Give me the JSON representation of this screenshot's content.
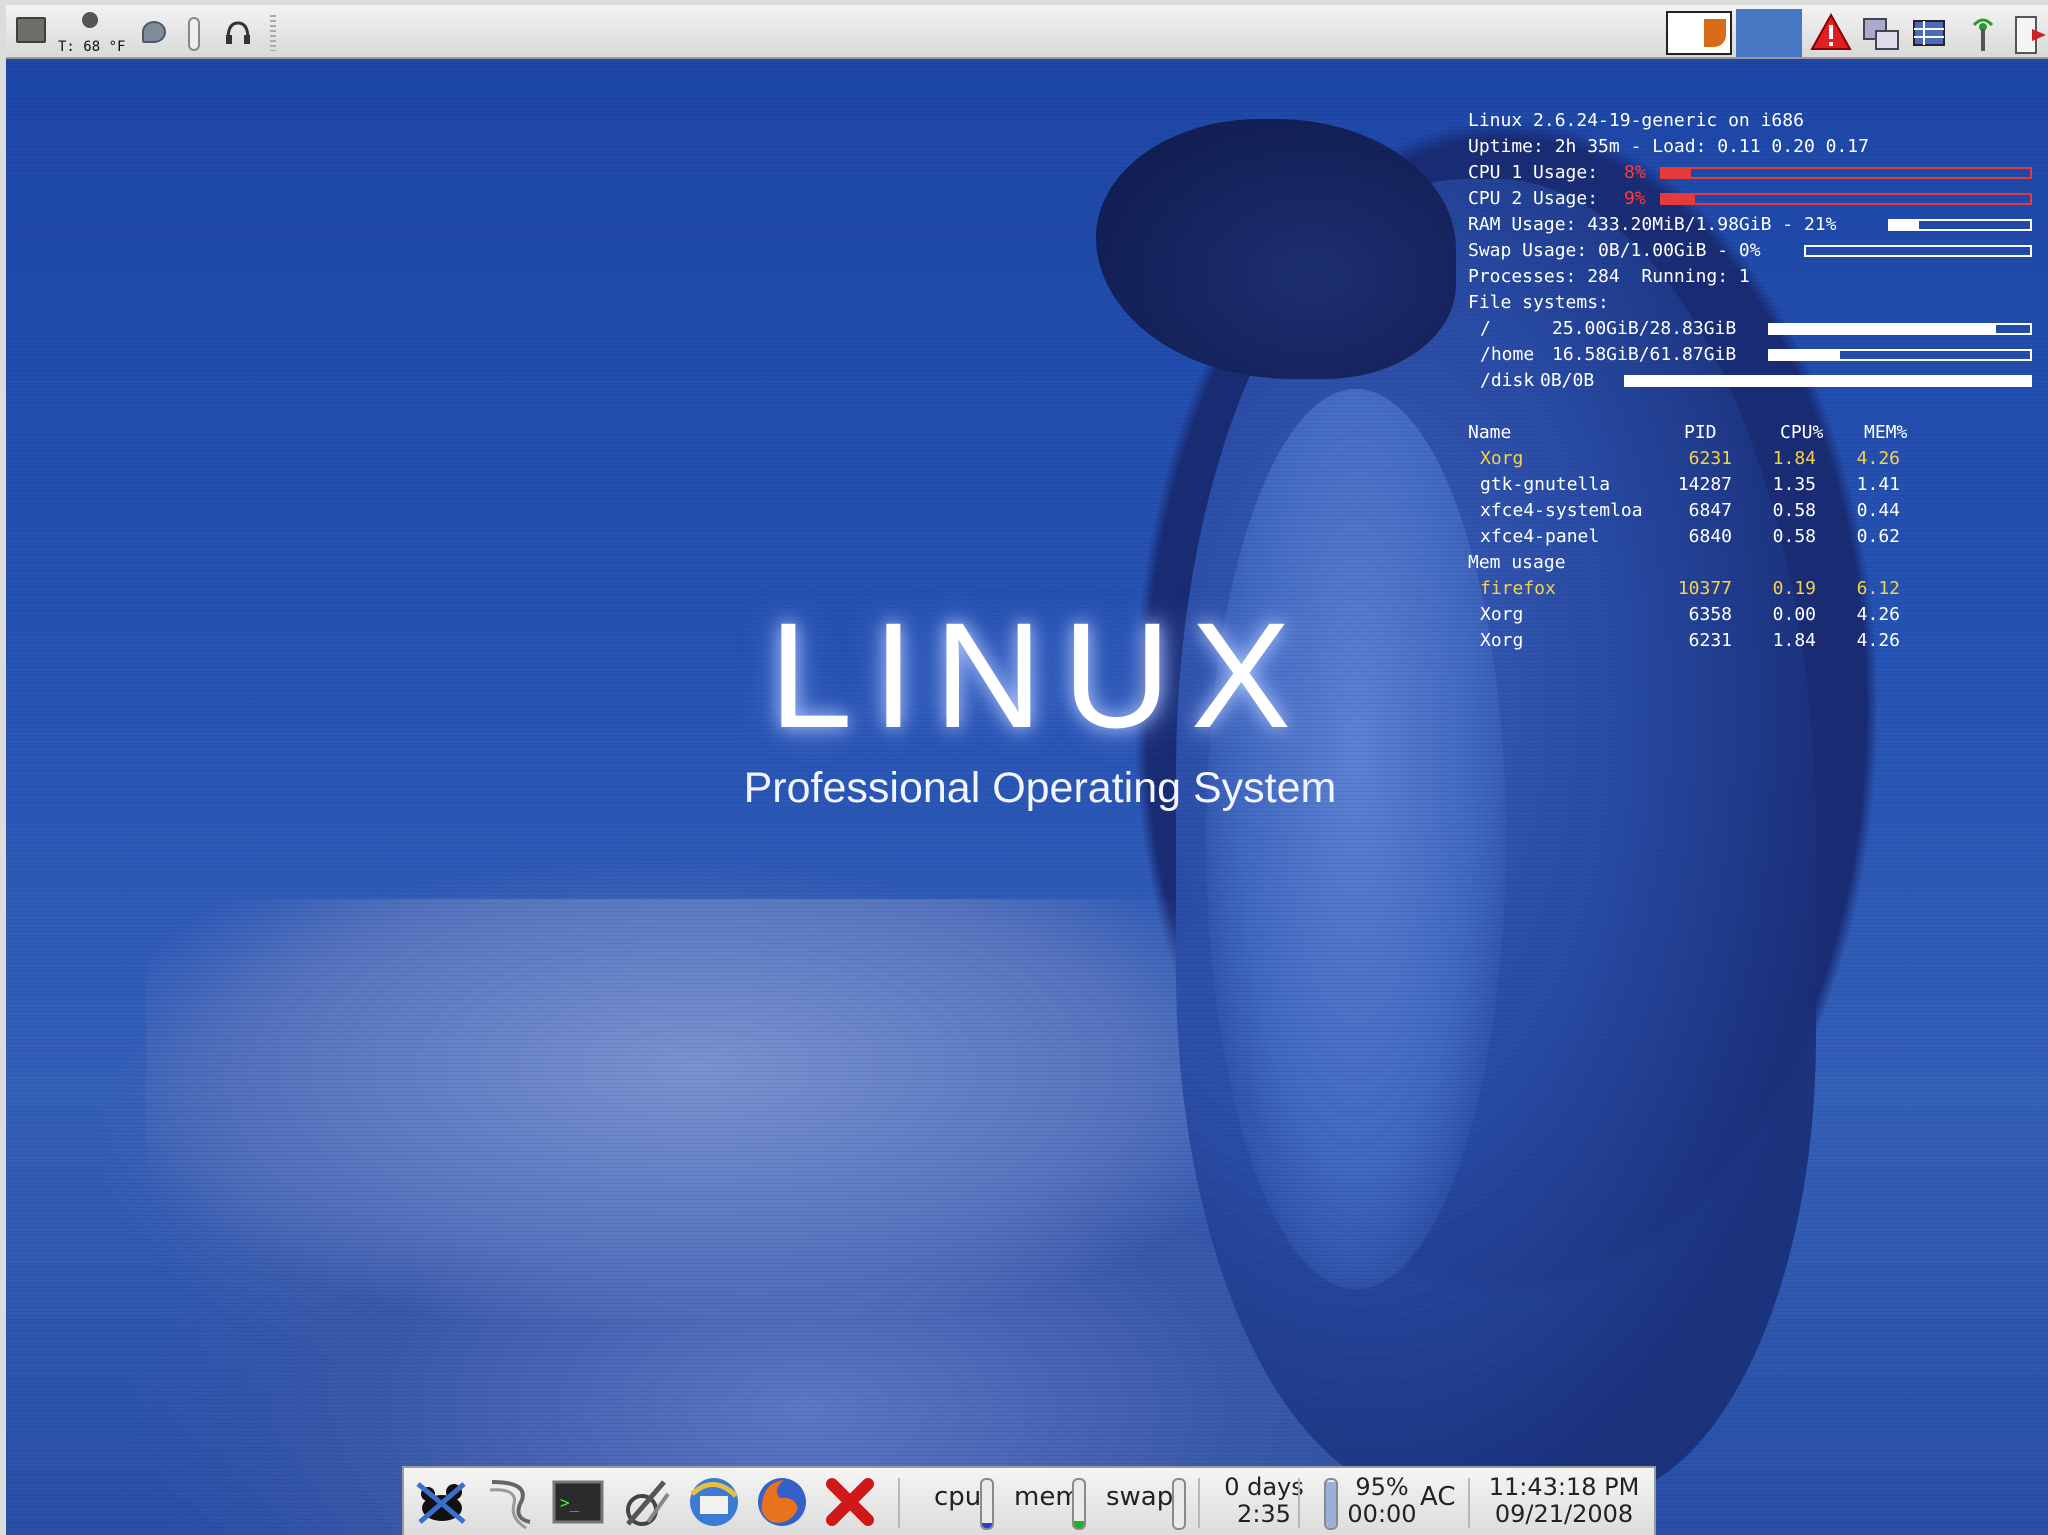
{
  "top_panel": {
    "temperature": "T: 68 °F",
    "icons": [
      "app-window-icon",
      "weather-icon",
      "volume-icon",
      "slider",
      "headphones-icon",
      "window-preview",
      "alert-icon",
      "network-icon",
      "firewall-icon",
      "wireless-icon",
      "logout-icon"
    ]
  },
  "wallpaper": {
    "logo_text": "LINUX",
    "tagline": "Professional Operating System"
  },
  "conky": {
    "kernel": "Linux 2.6.24-19-generic on i686",
    "uptime": "Uptime: 2h 35m - Load: 0.11 0.20 0.17",
    "cpu1_label": "CPU 1 Usage:",
    "cpu1_value": "8%",
    "cpu1_percent": 8,
    "cpu2_label": "CPU 2 Usage:",
    "cpu2_value": "9%",
    "cpu2_percent": 9,
    "ram": "RAM Usage: 433.20MiB/1.98GiB - 21%",
    "ram_percent": 21,
    "swap": "Swap Usage: 0B/1.00GiB - 0%",
    "swap_percent": 0,
    "processes": "Processes: 284  Running: 1",
    "fs_header": "File systems:",
    "fs": [
      {
        "mount": "/",
        "usage": "25.00GiB/28.83GiB",
        "percent": 87
      },
      {
        "mount": "/home",
        "usage": "16.58GiB/61.87GiB",
        "percent": 27
      },
      {
        "mount": "/disk",
        "usage": "0B/0B",
        "percent": 100
      }
    ],
    "table_headers": {
      "name": "Name",
      "pid": "PID",
      "cpu": "CPU%",
      "mem": "MEM%"
    },
    "top_cpu": [
      {
        "name": "Xorg",
        "pid": "6231",
        "cpu": "1.84",
        "mem": "4.26"
      },
      {
        "name": "gtk-gnutella",
        "pid": "14287",
        "cpu": "1.35",
        "mem": "1.41"
      },
      {
        "name": "xfce4-systemloa",
        "pid": "6847",
        "cpu": "0.58",
        "mem": "0.44"
      },
      {
        "name": "xfce4-panel",
        "pid": "6840",
        "cpu": "0.58",
        "mem": "0.62"
      }
    ],
    "mem_header": "Mem usage",
    "top_mem": [
      {
        "name": "firefox",
        "pid": "10377",
        "cpu": "0.19",
        "mem": "6.12"
      },
      {
        "name": "Xorg",
        "pid": "6358",
        "cpu": "0.00",
        "mem": "4.26"
      },
      {
        "name": "Xorg",
        "pid": "6231",
        "cpu": "1.84",
        "mem": "4.26"
      }
    ]
  },
  "bottom_panel": {
    "launchers": [
      "xfce-mouse-icon",
      "text-editor-icon",
      "terminal-icon",
      "system-tool-icon",
      "thunderbird-icon",
      "firefox-icon",
      "close-x-icon"
    ],
    "cpu_label": "cpu",
    "cpu_level": 10,
    "mem_label": "mem",
    "mem_level": 15,
    "swap_label": "swap",
    "swap_level": 0,
    "uptime_days": "0 days",
    "uptime_time": "2:35",
    "battery_percent": "95%",
    "battery_time": "00:00",
    "battery_level": 95,
    "power_source": "AC",
    "clock_time": "11:43:18 PM",
    "clock_date": "09/21/2008"
  },
  "colors": {
    "desktop_blue": "#2753b3",
    "conky_red": "#e43a3a",
    "conky_highlight": "#f6d24a"
  }
}
